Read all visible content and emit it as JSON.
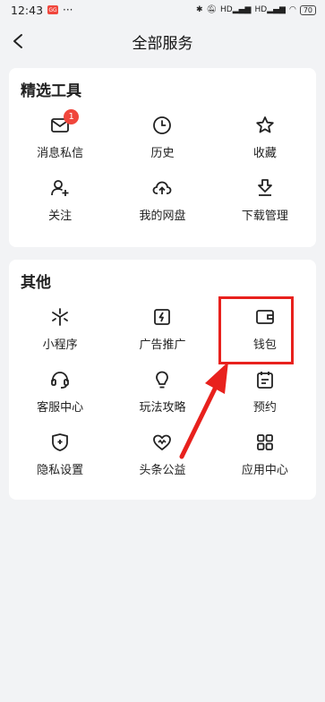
{
  "status_bar": {
    "time": "12:43",
    "app_badge": "GG",
    "dots": "···",
    "network": "HD",
    "battery": "70"
  },
  "header": {
    "title": "全部服务"
  },
  "tools": {
    "title": "精选工具",
    "items": [
      {
        "label": "消息私信",
        "icon": "mail-icon",
        "badge": "1"
      },
      {
        "label": "历史",
        "icon": "clock-icon"
      },
      {
        "label": "收藏",
        "icon": "star-icon"
      },
      {
        "label": "关注",
        "icon": "follow-user-icon"
      },
      {
        "label": "我的网盘",
        "icon": "cloud-upload-icon"
      },
      {
        "label": "下载管理",
        "icon": "download-icon"
      }
    ]
  },
  "others": {
    "title": "其他",
    "items": [
      {
        "label": "小程序",
        "icon": "mini-program-icon"
      },
      {
        "label": "广告推广",
        "icon": "lightning-icon"
      },
      {
        "label": "钱包",
        "icon": "wallet-icon"
      },
      {
        "label": "客服中心",
        "icon": "headset-icon"
      },
      {
        "label": "玩法攻略",
        "icon": "lightbulb-icon"
      },
      {
        "label": "预约",
        "icon": "calendar-icon"
      },
      {
        "label": "隐私设置",
        "icon": "shield-icon"
      },
      {
        "label": "头条公益",
        "icon": "charity-heart-icon"
      },
      {
        "label": "应用中心",
        "icon": "apps-grid-icon"
      }
    ]
  },
  "colors": {
    "accent_red": "#e8211d",
    "badge_red": "#f0463c",
    "background": "#f2f3f5"
  }
}
